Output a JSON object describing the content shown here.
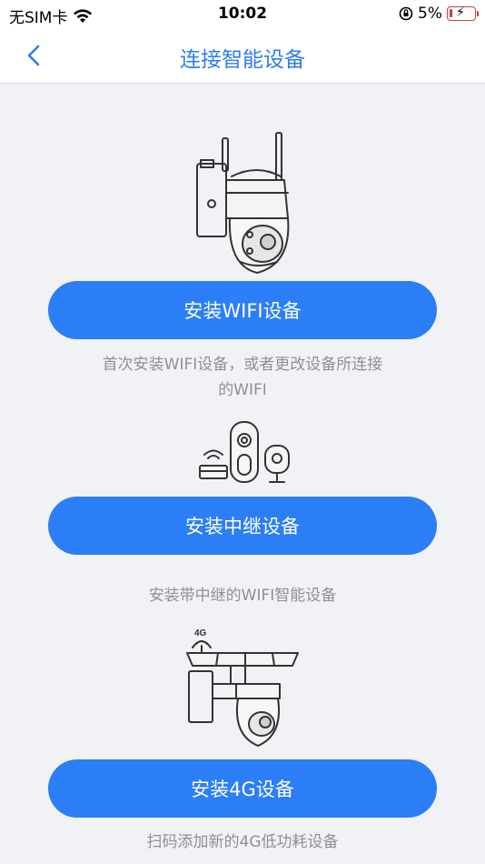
{
  "status_bar": {
    "carrier": "无SIM卡",
    "time": "10:02",
    "battery": "5%"
  },
  "nav": {
    "title": "连接智能设备"
  },
  "options": [
    {
      "button_label": "安装WIFI设备",
      "description_line1": "首次安装WIFI设备，或者更改设备所连接",
      "description_line2": "的WIFI",
      "illustration": "ptz-camera-icon"
    },
    {
      "button_label": "安装中继设备",
      "description_line1": "安装带中继的WIFI智能设备",
      "illustration": "repeater-devices-icon"
    },
    {
      "button_label": "安装4G设备",
      "description_line1": "扫码添加新的4G低功耗设备",
      "illustration": "solar-4g-camera-icon",
      "illustration_badge": "4G"
    }
  ],
  "colors": {
    "accent": "#2b7ef5",
    "title": "#2e7cf0",
    "background": "#f1f2f6",
    "description": "#8e9096"
  }
}
